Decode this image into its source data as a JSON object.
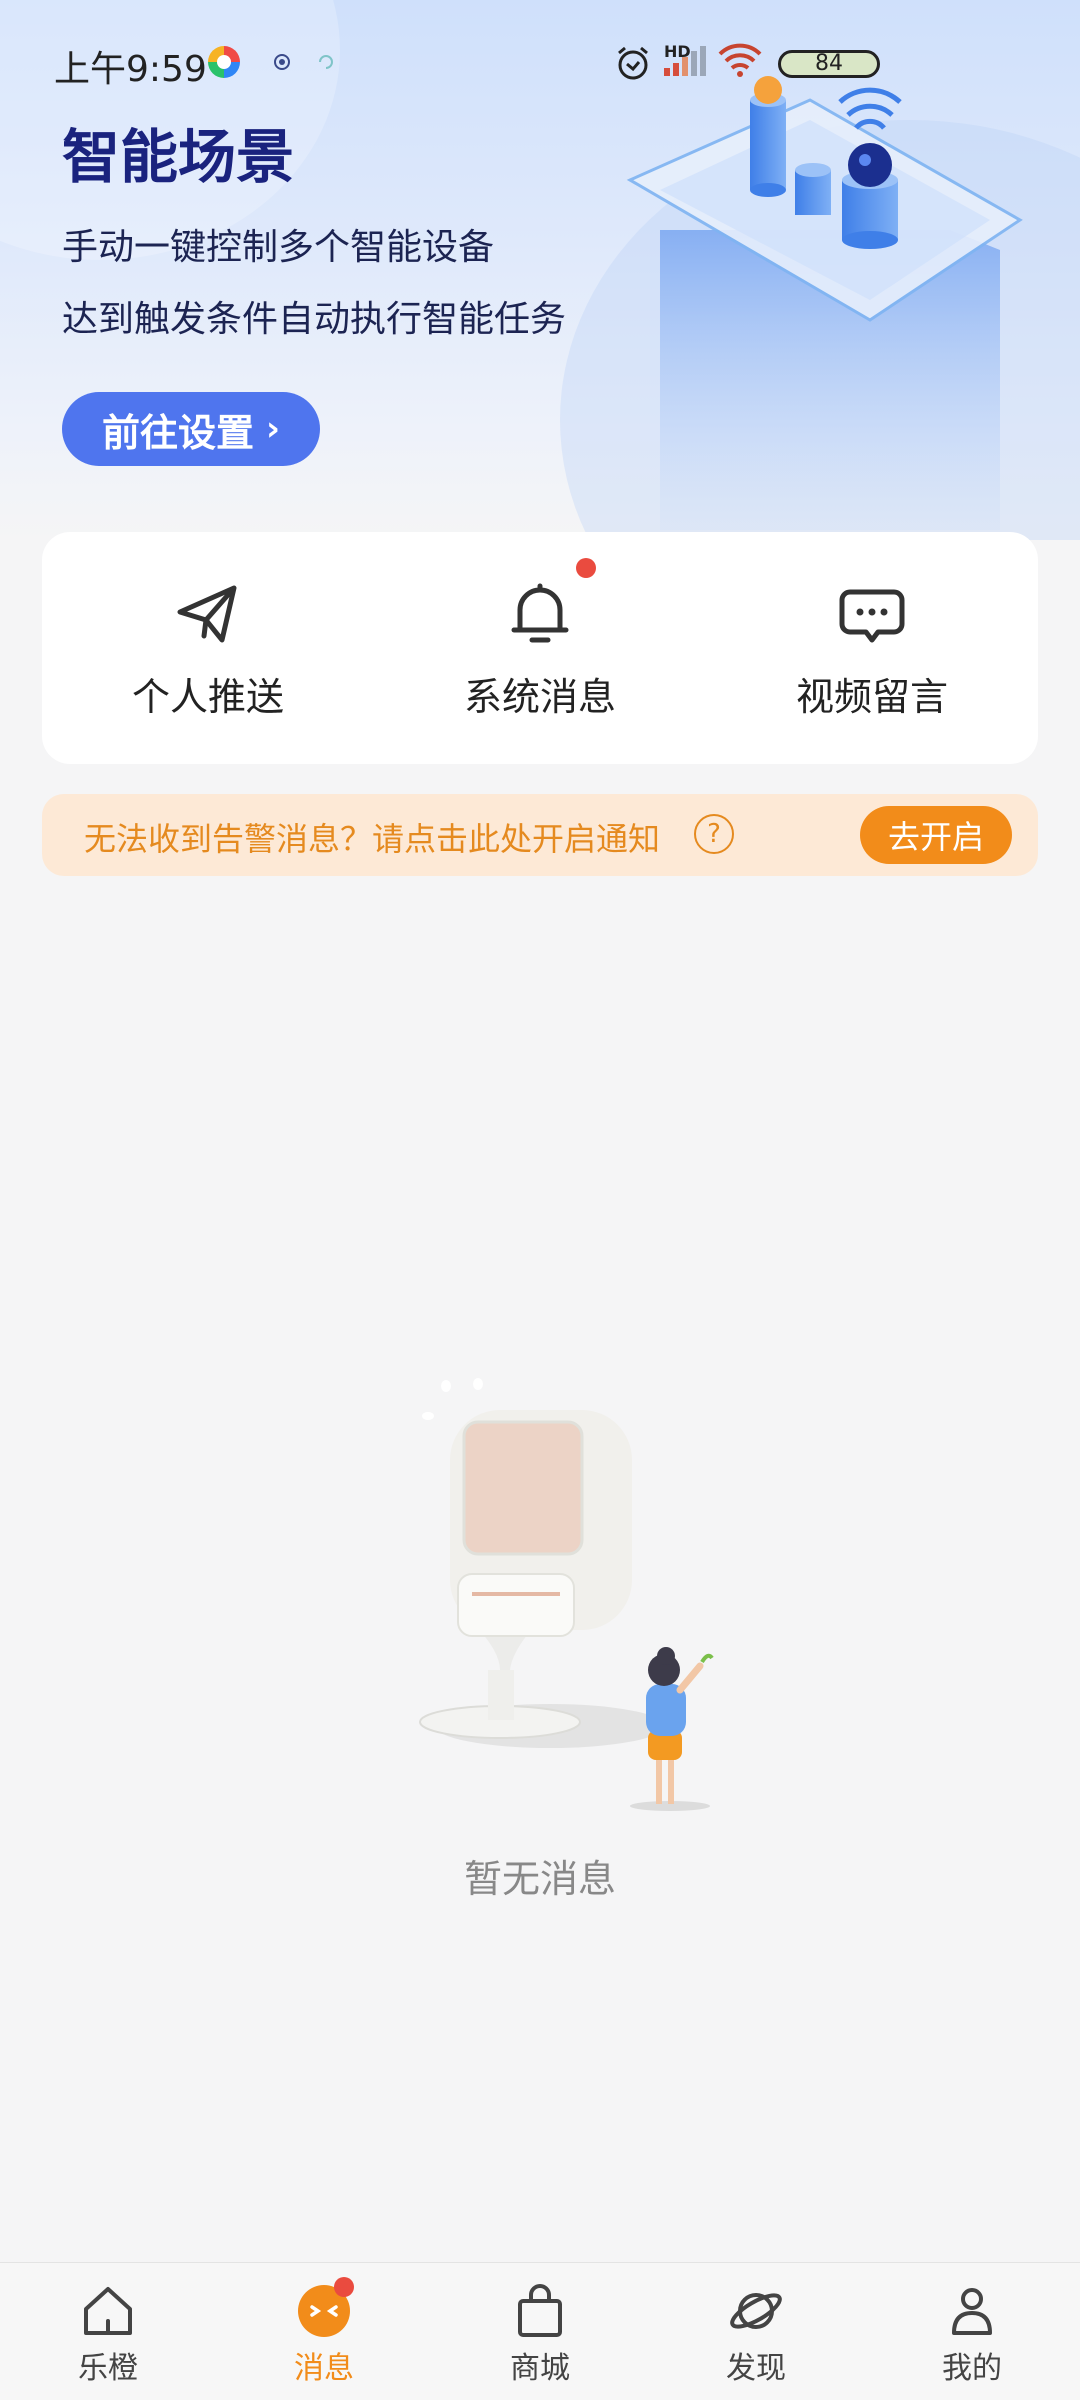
{
  "status_bar": {
    "time": "上午9:59",
    "network_label": "HD",
    "battery": "84"
  },
  "hero": {
    "title": "智能场景",
    "line1": "手动一键控制多个智能设备",
    "line2": "达到触发条件自动执行智能任务",
    "button_label": "前往设置"
  },
  "quick_entries": [
    {
      "label": "个人推送",
      "icon": "paper-plane-icon",
      "has_dot": false
    },
    {
      "label": "系统消息",
      "icon": "bell-icon",
      "has_dot": true
    },
    {
      "label": "视频留言",
      "icon": "chat-bubble-icon",
      "has_dot": false
    }
  ],
  "notice": {
    "text": "无法收到告警消息？请点击此处开启通知",
    "help": "?",
    "button_label": "去开启"
  },
  "empty_state": {
    "text": "暂无消息"
  },
  "bottom_nav": {
    "active_index": 1,
    "items": [
      {
        "label": "乐橙",
        "icon": "home-icon"
      },
      {
        "label": "消息",
        "icon": "message-icon",
        "has_dot": true
      },
      {
        "label": "商城",
        "icon": "shopping-bag-icon"
      },
      {
        "label": "发现",
        "icon": "planet-icon"
      },
      {
        "label": "我的",
        "icon": "person-icon"
      }
    ]
  },
  "colors": {
    "accent_blue": "#4f75ee",
    "accent_orange": "#f28c1a",
    "notice_bg": "#fde9d6",
    "badge_red": "#ea4b3f"
  }
}
